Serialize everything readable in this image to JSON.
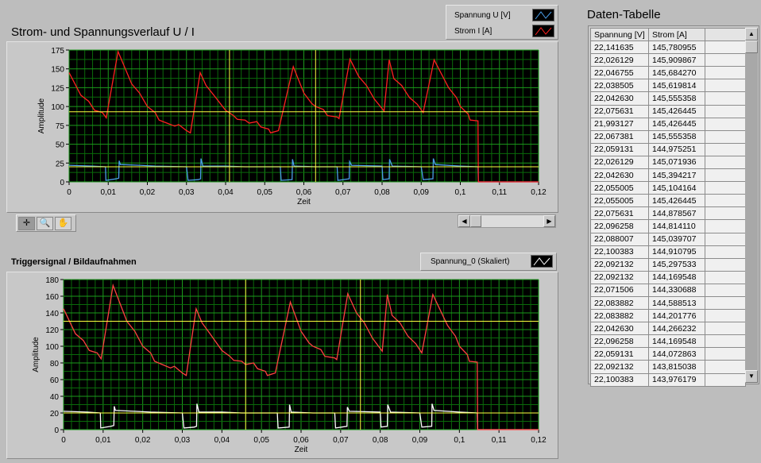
{
  "chart1": {
    "title": "Strom- und Spannungsverlauf U / I",
    "legend": [
      {
        "label": "Spannung U [V]",
        "color": "#4a9ee8"
      },
      {
        "label": "Strom I [A]",
        "color": "#ff2020"
      }
    ]
  },
  "chart2": {
    "title": "Triggersignal / Bildaufnahmen",
    "legend": [
      {
        "label": "Spannung_0 (Skaliert)",
        "color": "#ffffff"
      }
    ]
  },
  "toolbar": {
    "icons": [
      "cursor-icon",
      "zoom-icon",
      "pan-hand-icon"
    ]
  },
  "table": {
    "title": "Daten-Tabelle",
    "headers": [
      "Spannung [V]",
      "Strom [A]",
      ""
    ],
    "rows": [
      [
        "22,141635",
        "145,780955"
      ],
      [
        "22,026129",
        "145,909867"
      ],
      [
        "22,046755",
        "145,684270"
      ],
      [
        "22,038505",
        "145,619814"
      ],
      [
        "22,042630",
        "145,555358"
      ],
      [
        "22,075631",
        "145,426445"
      ],
      [
        "21,993127",
        "145,426445"
      ],
      [
        "22,067381",
        "145,555358"
      ],
      [
        "22,059131",
        "144,975251"
      ],
      [
        "22,026129",
        "145,071936"
      ],
      [
        "22,042630",
        "145,394217"
      ],
      [
        "22,055005",
        "145,104164"
      ],
      [
        "22,055005",
        "145,426445"
      ],
      [
        "22,075631",
        "144,878567"
      ],
      [
        "22,096258",
        "144,814110"
      ],
      [
        "22,088007",
        "145,039707"
      ],
      [
        "22,100383",
        "144,910795"
      ],
      [
        "22,092132",
        "145,297533"
      ],
      [
        "22,092132",
        "144,169548"
      ],
      [
        "22,071506",
        "144,330688"
      ],
      [
        "22,083882",
        "144,588513"
      ],
      [
        "22,083882",
        "144,201776"
      ],
      [
        "22,042630",
        "144,266232"
      ],
      [
        "22,096258",
        "144,169548"
      ],
      [
        "22,059131",
        "144,072863"
      ],
      [
        "22,092132",
        "143,815038"
      ],
      [
        "22,100383",
        "143,976179"
      ]
    ]
  },
  "chart_data": [
    {
      "type": "line",
      "xlabel": "Zeit",
      "ylabel": "Amplitude",
      "xlim": [
        0,
        0.12
      ],
      "ylim": [
        0,
        175
      ],
      "xticks": [
        "0",
        "0,01",
        "0,02",
        "0,03",
        "0,04",
        "0,05",
        "0,06",
        "0,07",
        "0,08",
        "0,09",
        "0,1",
        "0,11",
        "0,12"
      ],
      "yticks": [
        "0",
        "25",
        "50",
        "75",
        "100",
        "125",
        "150",
        "175"
      ],
      "ystep": 25,
      "grid": true,
      "cursors": {
        "x": [
          0.041,
          0.063
        ],
        "y": [
          93,
          20
        ]
      },
      "series": [
        {
          "name": "Strom I [A]",
          "color": "#ff2020",
          "points": [
            [
              0,
              145
            ],
            [
              0.003,
              115
            ],
            [
              0.005,
              107
            ],
            [
              0.0065,
              95
            ],
            [
              0.0085,
              92
            ],
            [
              0.0095,
              85
            ],
            [
              0.0125,
              173
            ],
            [
              0.016,
              130
            ],
            [
              0.018,
              118
            ],
            [
              0.02,
              100
            ],
            [
              0.022,
              92
            ],
            [
              0.023,
              82
            ],
            [
              0.025,
              78
            ],
            [
              0.027,
              74
            ],
            [
              0.028,
              76
            ],
            [
              0.03,
              68
            ],
            [
              0.031,
              65
            ],
            [
              0.0335,
              145
            ],
            [
              0.035,
              128
            ],
            [
              0.037,
              115
            ],
            [
              0.04,
              95
            ],
            [
              0.042,
              88
            ],
            [
              0.043,
              83
            ],
            [
              0.045,
              82
            ],
            [
              0.046,
              78
            ],
            [
              0.048,
              80
            ],
            [
              0.049,
              73
            ],
            [
              0.051,
              70
            ],
            [
              0.0515,
              65
            ],
            [
              0.0535,
              68
            ],
            [
              0.0573,
              153
            ],
            [
              0.06,
              118
            ],
            [
              0.062,
              104
            ],
            [
              0.063,
              100
            ],
            [
              0.065,
              96
            ],
            [
              0.066,
              88
            ],
            [
              0.0685,
              86
            ],
            [
              0.069,
              84
            ],
            [
              0.0718,
              163
            ],
            [
              0.074,
              140
            ],
            [
              0.076,
              128
            ],
            [
              0.078,
              110
            ],
            [
              0.0805,
              94
            ],
            [
              0.0818,
              162
            ],
            [
              0.083,
              137
            ],
            [
              0.085,
              128
            ],
            [
              0.087,
              112
            ],
            [
              0.089,
              103
            ],
            [
              0.0905,
              92
            ],
            [
              0.0933,
              162
            ],
            [
              0.097,
              125
            ],
            [
              0.099,
              112
            ],
            [
              0.1,
              100
            ],
            [
              0.102,
              90
            ],
            [
              0.1025,
              82
            ],
            [
              0.1045,
              81
            ],
            [
              0.1046,
              0
            ],
            [
              0.12,
              0
            ]
          ]
        },
        {
          "name": "Spannung U [V]",
          "color": "#4a9ee8",
          "points": [
            [
              0,
              22
            ],
            [
              0.006,
              21
            ],
            [
              0.0093,
              20
            ],
            [
              0.0094,
              2
            ],
            [
              0.012,
              4
            ],
            [
              0.0127,
              5
            ],
            [
              0.0128,
              28
            ],
            [
              0.0131,
              23
            ],
            [
              0.018,
              22
            ],
            [
              0.022,
              21
            ],
            [
              0.03,
              20
            ],
            [
              0.0304,
              2
            ],
            [
              0.033,
              3
            ],
            [
              0.0336,
              4
            ],
            [
              0.0337,
              31
            ],
            [
              0.0342,
              21
            ],
            [
              0.04,
              21
            ],
            [
              0.045,
              20
            ],
            [
              0.054,
              20
            ],
            [
              0.0542,
              2
            ],
            [
              0.057,
              3
            ],
            [
              0.0571,
              30
            ],
            [
              0.0575,
              21
            ],
            [
              0.063,
              20
            ],
            [
              0.0685,
              20
            ],
            [
              0.0687,
              2
            ],
            [
              0.0716,
              4
            ],
            [
              0.0717,
              27
            ],
            [
              0.0722,
              22
            ],
            [
              0.08,
              21
            ],
            [
              0.0802,
              3
            ],
            [
              0.0818,
              4
            ],
            [
              0.0819,
              30
            ],
            [
              0.0826,
              21
            ],
            [
              0.09,
              20
            ],
            [
              0.0905,
              3
            ],
            [
              0.093,
              4
            ],
            [
              0.0931,
              31
            ],
            [
              0.0936,
              23
            ],
            [
              0.1,
              21
            ],
            [
              0.1045,
              20
            ],
            [
              0.1046,
              0
            ],
            [
              0.12,
              0
            ]
          ]
        }
      ]
    },
    {
      "type": "line",
      "xlabel": "Zeit",
      "ylabel": "Amplitude",
      "xlim": [
        0,
        0.12
      ],
      "ylim": [
        0,
        180
      ],
      "xticks": [
        "0",
        "0,01",
        "0,02",
        "0,03",
        "0,04",
        "0,05",
        "0,06",
        "0,07",
        "0,08",
        "0,09",
        "0,1",
        "0,11",
        "0,12"
      ],
      "yticks": [
        "0",
        "20",
        "40",
        "60",
        "80",
        "100",
        "120",
        "140",
        "160",
        "180"
      ],
      "ystep": 20,
      "grid": true,
      "cursors": {
        "x": [
          0.046,
          0.075
        ],
        "y": [
          130,
          20
        ]
      },
      "series": [
        {
          "name": "Strom I [A]",
          "color": "#ff4040",
          "points": [
            [
              0,
              145
            ],
            [
              0.003,
              115
            ],
            [
              0.005,
              107
            ],
            [
              0.0065,
              95
            ],
            [
              0.0085,
              92
            ],
            [
              0.0095,
              85
            ],
            [
              0.0125,
              173
            ],
            [
              0.016,
              130
            ],
            [
              0.018,
              118
            ],
            [
              0.02,
              100
            ],
            [
              0.022,
              92
            ],
            [
              0.023,
              82
            ],
            [
              0.025,
              78
            ],
            [
              0.027,
              74
            ],
            [
              0.028,
              76
            ],
            [
              0.03,
              68
            ],
            [
              0.031,
              65
            ],
            [
              0.0335,
              145
            ],
            [
              0.035,
              128
            ],
            [
              0.037,
              115
            ],
            [
              0.04,
              95
            ],
            [
              0.042,
              88
            ],
            [
              0.043,
              83
            ],
            [
              0.045,
              82
            ],
            [
              0.046,
              78
            ],
            [
              0.048,
              80
            ],
            [
              0.049,
              73
            ],
            [
              0.051,
              70
            ],
            [
              0.0515,
              65
            ],
            [
              0.0535,
              68
            ],
            [
              0.0573,
              153
            ],
            [
              0.06,
              118
            ],
            [
              0.062,
              104
            ],
            [
              0.063,
              100
            ],
            [
              0.065,
              96
            ],
            [
              0.066,
              88
            ],
            [
              0.0685,
              86
            ],
            [
              0.069,
              84
            ],
            [
              0.0718,
              163
            ],
            [
              0.074,
              140
            ],
            [
              0.076,
              128
            ],
            [
              0.078,
              110
            ],
            [
              0.0805,
              94
            ],
            [
              0.0818,
              162
            ],
            [
              0.083,
              137
            ],
            [
              0.085,
              128
            ],
            [
              0.087,
              112
            ],
            [
              0.089,
              103
            ],
            [
              0.0905,
              92
            ],
            [
              0.0933,
              162
            ],
            [
              0.097,
              125
            ],
            [
              0.099,
              112
            ],
            [
              0.1,
              100
            ],
            [
              0.102,
              90
            ],
            [
              0.1025,
              82
            ],
            [
              0.1045,
              81
            ],
            [
              0.1046,
              0
            ],
            [
              0.12,
              0
            ]
          ]
        },
        {
          "name": "Spannung_0 (Skaliert)",
          "color": "#ffffff",
          "points": [
            [
              0,
              22
            ],
            [
              0.006,
              21
            ],
            [
              0.0093,
              20
            ],
            [
              0.0094,
              2
            ],
            [
              0.012,
              4
            ],
            [
              0.0127,
              5
            ],
            [
              0.0128,
              28
            ],
            [
              0.0131,
              23
            ],
            [
              0.018,
              22
            ],
            [
              0.022,
              21
            ],
            [
              0.03,
              20
            ],
            [
              0.0304,
              2
            ],
            [
              0.033,
              3
            ],
            [
              0.0336,
              4
            ],
            [
              0.0337,
              31
            ],
            [
              0.0342,
              21
            ],
            [
              0.04,
              21
            ],
            [
              0.045,
              20
            ],
            [
              0.054,
              20
            ],
            [
              0.0542,
              2
            ],
            [
              0.057,
              3
            ],
            [
              0.0571,
              30
            ],
            [
              0.0575,
              21
            ],
            [
              0.063,
              20
            ],
            [
              0.0685,
              20
            ],
            [
              0.0687,
              2
            ],
            [
              0.0716,
              4
            ],
            [
              0.0717,
              27
            ],
            [
              0.0722,
              22
            ],
            [
              0.08,
              21
            ],
            [
              0.0802,
              3
            ],
            [
              0.0818,
              4
            ],
            [
              0.0819,
              30
            ],
            [
              0.0826,
              21
            ],
            [
              0.09,
              20
            ],
            [
              0.0905,
              3
            ],
            [
              0.093,
              4
            ],
            [
              0.0931,
              31
            ],
            [
              0.0936,
              23
            ],
            [
              0.1,
              21
            ],
            [
              0.1045,
              20
            ],
            [
              0.1046,
              0
            ],
            [
              0.12,
              0
            ]
          ]
        }
      ]
    }
  ]
}
